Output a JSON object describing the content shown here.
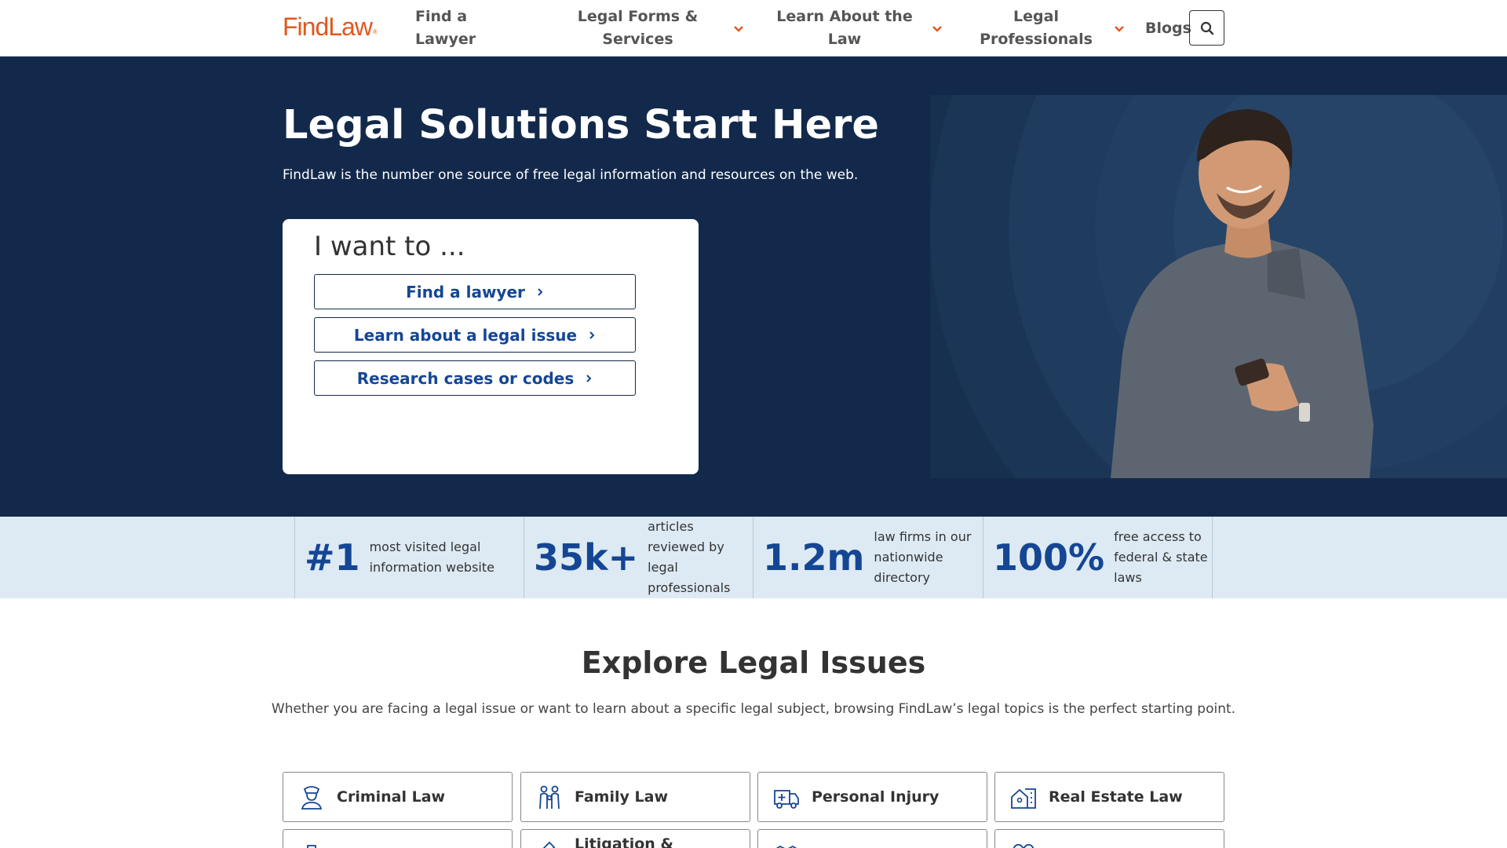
{
  "header": {
    "logo": "FindLaw",
    "nav": [
      {
        "line1": "Find a",
        "line2": "Lawyer"
      },
      {
        "line1": "Legal Forms &",
        "line2": "Services"
      },
      {
        "line1": "Learn About the",
        "line2": "Law"
      },
      {
        "line1": "Legal",
        "line2": "Professionals"
      },
      {
        "line1": "Blogs",
        "line2": ""
      }
    ]
  },
  "hero": {
    "title": "Legal Solutions Start Here",
    "subtitle": "FindLaw is the number one source of free legal information and resources on the web.",
    "card_title": "I want to ...",
    "buttons": [
      "Find a lawyer",
      "Learn about a legal issue",
      "Research cases or codes"
    ]
  },
  "stats": [
    {
      "number": "#1",
      "desc": [
        "most visited legal",
        "information website"
      ]
    },
    {
      "number": "35k+",
      "desc": [
        "articles",
        "reviewed by",
        "legal",
        "professionals"
      ]
    },
    {
      "number": "1.2m",
      "desc": [
        "law firms in our",
        "nationwide",
        "directory"
      ]
    },
    {
      "number": "100%",
      "desc": [
        "free access to",
        "federal & state",
        "laws"
      ]
    }
  ],
  "explore": {
    "title": "Explore Legal Issues",
    "subtitle": "Whether you are facing a legal issue or want to learn about a specific legal subject, browsing FindLaw’s legal topics is the perfect starting point.",
    "tiles": [
      {
        "label": "Criminal Law",
        "icon": "police-officer-icon"
      },
      {
        "label": "Family Law",
        "icon": "family-icon"
      },
      {
        "label": "Personal Injury",
        "icon": "ambulance-icon"
      },
      {
        "label": "Real Estate Law",
        "icon": "house-building-icon"
      },
      {
        "label": "",
        "icon": "briefcase-icon"
      },
      {
        "label": "Litigation &",
        "icon": "gavel-icon"
      },
      {
        "label": "",
        "icon": "handshake-icon"
      },
      {
        "label": "",
        "icon": "heart-icon"
      }
    ]
  },
  "colors": {
    "brand_orange": "#e2571f",
    "navy": "#13294b",
    "link_blue": "#154694",
    "stats_bg": "#ddeaf3"
  }
}
